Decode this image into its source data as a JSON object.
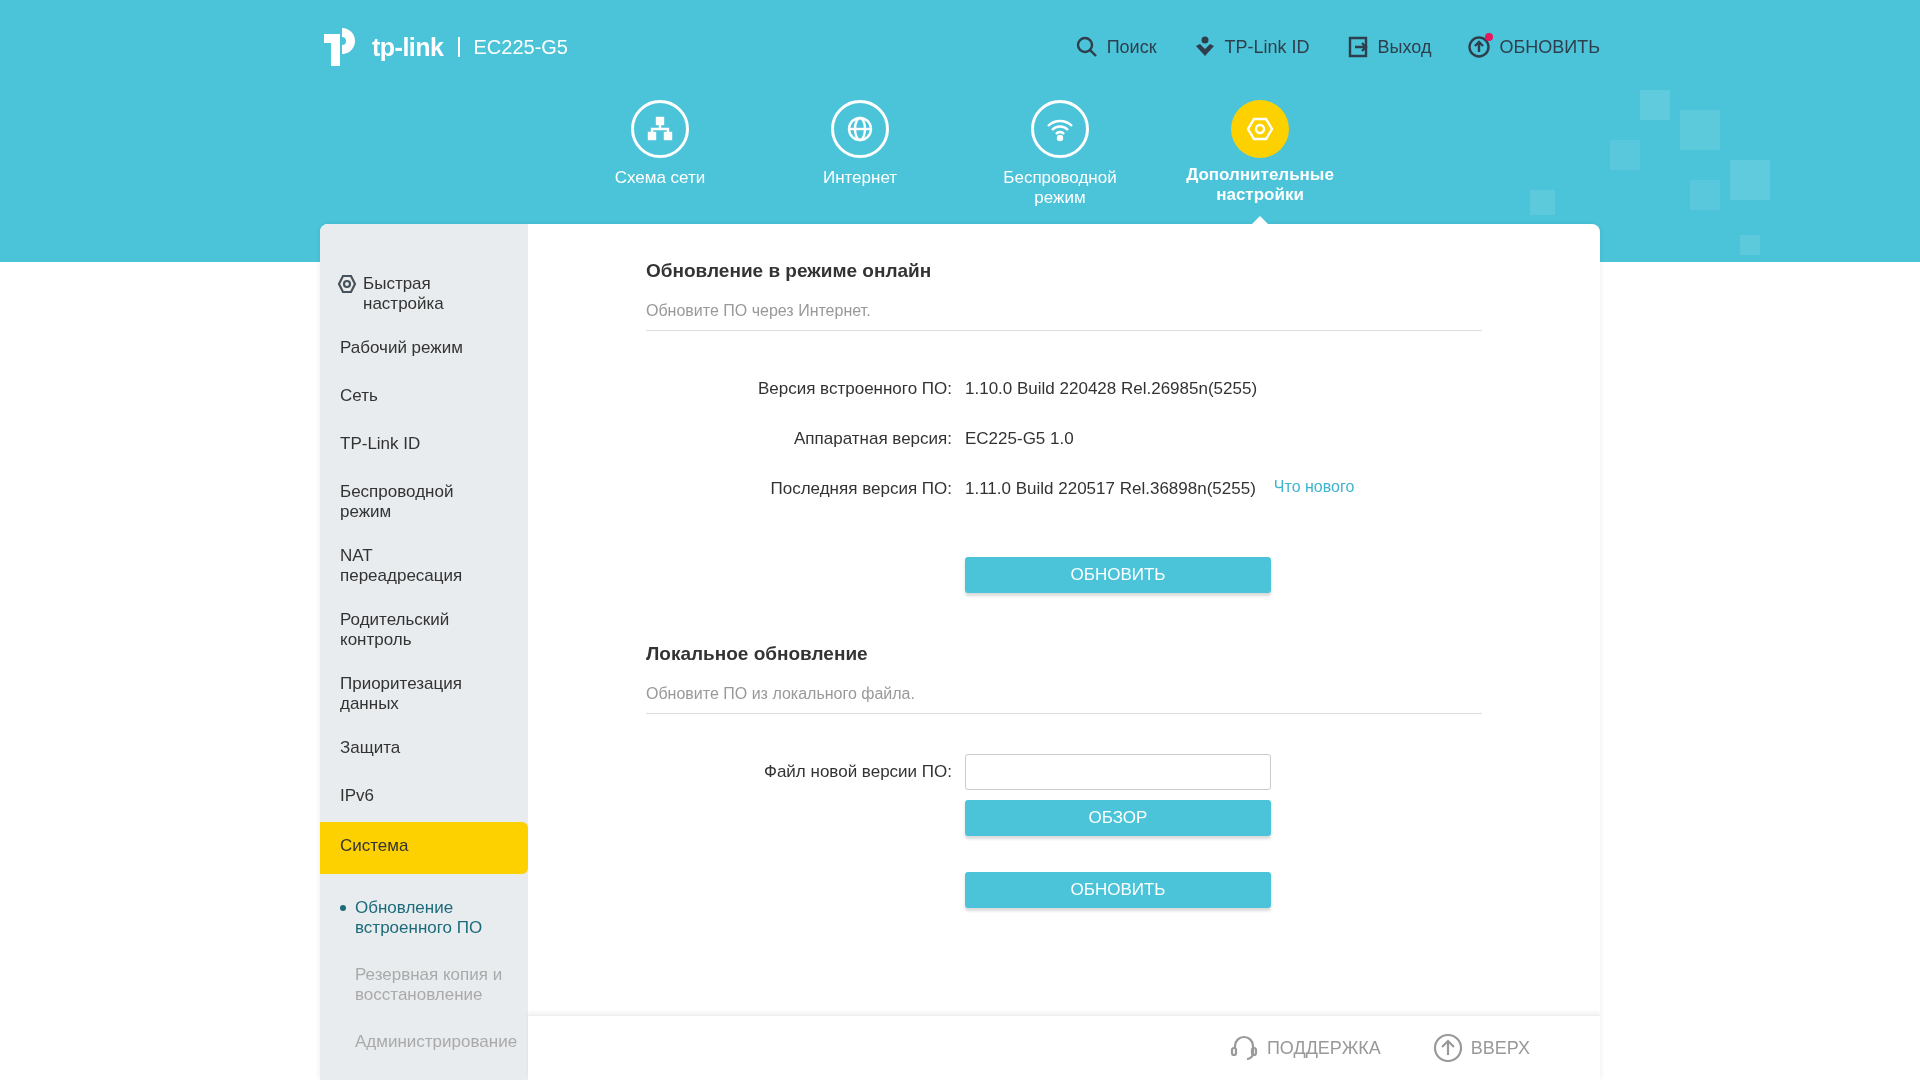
{
  "header": {
    "brand": "tp-link",
    "model": "EC225-G5",
    "links": [
      {
        "kind": "search",
        "label": "Поиск",
        "notification": false
      },
      {
        "kind": "account",
        "label": "TP-Link ID",
        "notification": false
      },
      {
        "kind": "logout",
        "label": "Выход",
        "notification": false
      },
      {
        "kind": "update",
        "label": "ОБНОВИТЬ",
        "notification": true
      }
    ]
  },
  "nav_tabs": [
    {
      "kind": "network",
      "label": "Схема сети",
      "selected": false
    },
    {
      "kind": "internet",
      "label": "Интернет",
      "selected": false
    },
    {
      "kind": "wireless",
      "label": "Беспроводной режим",
      "selected": false
    },
    {
      "kind": "advanced",
      "label": "Дополнительные настройки",
      "selected": true
    }
  ],
  "sidebar": {
    "items": [
      {
        "kind": "quick",
        "label": "Быстрая настройка",
        "selected": false
      },
      {
        "kind": "item",
        "label": "Рабочий режим",
        "selected": false
      },
      {
        "kind": "item",
        "label": "Сеть",
        "selected": false
      },
      {
        "kind": "item",
        "label": "TP-Link ID",
        "selected": false
      },
      {
        "kind": "item",
        "label": "Беспроводной режим",
        "selected": false
      },
      {
        "kind": "item",
        "label": "NAT переадресация",
        "selected": false
      },
      {
        "kind": "item",
        "label": "Родительский контроль",
        "selected": false
      },
      {
        "kind": "item",
        "label": "Приоритезация данных",
        "selected": false
      },
      {
        "kind": "item",
        "label": "Защита",
        "selected": false
      },
      {
        "kind": "item",
        "label": "IPv6",
        "selected": false
      },
      {
        "kind": "item",
        "label": "Система",
        "selected": true,
        "children": [
          {
            "label": "Обновление встроенного ПО",
            "selected": true
          },
          {
            "label": "Резервная копия и восстановление",
            "selected": false
          },
          {
            "label": "Администрирование",
            "selected": false
          }
        ]
      }
    ]
  },
  "sections": [
    {
      "title": "Обновление в режиме онлайн",
      "subtitle": "Обновите ПО через Интернет.",
      "rows": [
        {
          "kind": "info",
          "label": "Версия встроенного ПО:",
          "value": "1.10.0 Build 220428 Rel.26985n(5255)"
        },
        {
          "kind": "info",
          "label": "Аппаратная версия:",
          "value": "EC225-G5 1.0"
        },
        {
          "kind": "info",
          "label": "Последняя версия ПО:",
          "value": "1.11.0 Build 220517 Rel.36898n(5255)",
          "link": "Что нового"
        },
        {
          "kind": "button",
          "label": "ОБНОВИТЬ"
        }
      ]
    },
    {
      "title": "Локальное обновление",
      "subtitle": "Обновите ПО из локального файла.",
      "rows": [
        {
          "kind": "file",
          "label": "Файл новой версии ПО:"
        },
        {
          "kind": "button",
          "label": "ОБЗОР"
        },
        {
          "kind": "button",
          "label": "ОБНОВИТЬ"
        }
      ]
    }
  ],
  "footer": [
    {
      "kind": "support",
      "label": "ПОДДЕРЖКА"
    },
    {
      "kind": "top",
      "label": "ВВЕРХ"
    }
  ]
}
